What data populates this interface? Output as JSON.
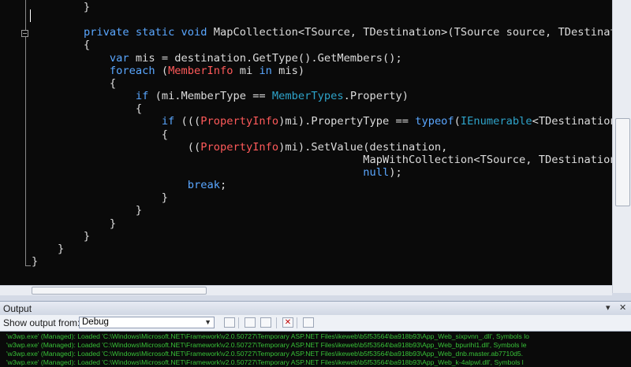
{
  "editor": {
    "lines": [
      [
        {
          "t": "        }",
          "c": "pl"
        }
      ],
      [],
      [
        {
          "t": "        ",
          "c": "pl"
        },
        {
          "t": "private static void",
          "c": "kw"
        },
        {
          "t": " MapCollection<TSource, TDestination>(TSource source, TDestinatio",
          "c": "pl"
        }
      ],
      [
        {
          "t": "        {",
          "c": "pl"
        }
      ],
      [
        {
          "t": "            ",
          "c": "pl"
        },
        {
          "t": "var",
          "c": "kw"
        },
        {
          "t": " mis = destination.GetType().GetMembers();",
          "c": "pl"
        }
      ],
      [
        {
          "t": "            ",
          "c": "pl"
        },
        {
          "t": "foreach",
          "c": "kw"
        },
        {
          "t": " (",
          "c": "pl"
        },
        {
          "t": "MemberInfo",
          "c": "cl"
        },
        {
          "t": " mi ",
          "c": "pl"
        },
        {
          "t": "in",
          "c": "kw"
        },
        {
          "t": " mis)",
          "c": "pl"
        }
      ],
      [
        {
          "t": "            {",
          "c": "pl"
        }
      ],
      [
        {
          "t": "                ",
          "c": "pl"
        },
        {
          "t": "if",
          "c": "kw"
        },
        {
          "t": " (mi.MemberType == ",
          "c": "pl"
        },
        {
          "t": "MemberTypes",
          "c": "ty"
        },
        {
          "t": ".Property)",
          "c": "pl"
        }
      ],
      [
        {
          "t": "                {",
          "c": "pl"
        }
      ],
      [
        {
          "t": "                    ",
          "c": "pl"
        },
        {
          "t": "if",
          "c": "kw"
        },
        {
          "t": " (((",
          "c": "pl"
        },
        {
          "t": "PropertyInfo",
          "c": "cl"
        },
        {
          "t": ")mi).PropertyType == ",
          "c": "pl"
        },
        {
          "t": "typeof",
          "c": "kw"
        },
        {
          "t": "(",
          "c": "pl"
        },
        {
          "t": "IEnumerable",
          "c": "ty"
        },
        {
          "t": "<TDestination>)",
          "c": "pl"
        }
      ],
      [
        {
          "t": "                    {",
          "c": "pl"
        }
      ],
      [
        {
          "t": "                        ((",
          "c": "pl"
        },
        {
          "t": "PropertyInfo",
          "c": "cl"
        },
        {
          "t": ")mi).SetValue(destination,",
          "c": "pl"
        }
      ],
      [
        {
          "t": "                                                   MapWithCollection<TSource, TDestination>",
          "c": "pl"
        }
      ],
      [
        {
          "t": "                                                   ",
          "c": "pl"
        },
        {
          "t": "null",
          "c": "kw"
        },
        {
          "t": ");",
          "c": "pl"
        }
      ],
      [
        {
          "t": "                        ",
          "c": "pl"
        },
        {
          "t": "break",
          "c": "kw"
        },
        {
          "t": ";",
          "c": "pl"
        }
      ],
      [
        {
          "t": "                    }",
          "c": "pl"
        }
      ],
      [
        {
          "t": "                }",
          "c": "pl"
        }
      ],
      [
        {
          "t": "            }",
          "c": "pl"
        }
      ],
      [
        {
          "t": "        }",
          "c": "pl"
        }
      ],
      [
        {
          "t": "    }",
          "c": "pl"
        }
      ],
      [
        {
          "t": "}",
          "c": "pl"
        }
      ]
    ]
  },
  "output": {
    "title": "Output",
    "pin_icon": "▾",
    "close_icon": "✕",
    "show_from_label": "Show output from:",
    "source_value": "Debug",
    "lines": [
      "'w3wp.exe' (Managed): Loaded 'C:\\Windows\\Microsoft.NET\\Framework\\v2.0.50727\\Temporary ASP.NET Files\\ikeweb\\b5f53564\\ba918b93\\App_Web_sixpvnn_.dll', Symbols lo",
      "'w3wp.exe' (Managed): Loaded 'C:\\Windows\\Microsoft.NET\\Framework\\v2.0.50727\\Temporary ASP.NET Files\\ikeweb\\b5f53564\\ba918b93\\App_Web_bpurihl1.dll', Symbols le",
      "'w3wp.exe' (Managed): Loaded 'C:\\Windows\\Microsoft.NET\\Framework\\v2.0.50727\\Temporary ASP.NET Files\\ikeweb\\b5f53564\\ba918b93\\App_Web_dnb.master.ab7710d5.",
      "'w3wp.exe' (Managed): Loaded 'C:\\Windows\\Microsoft.NET\\Framework\\v2.0.50727\\Temporary ASP.NET Files\\ikeweb\\b5f53564\\ba918b93\\App_Web_k-4alpwl.dll', Symbols l"
    ]
  }
}
